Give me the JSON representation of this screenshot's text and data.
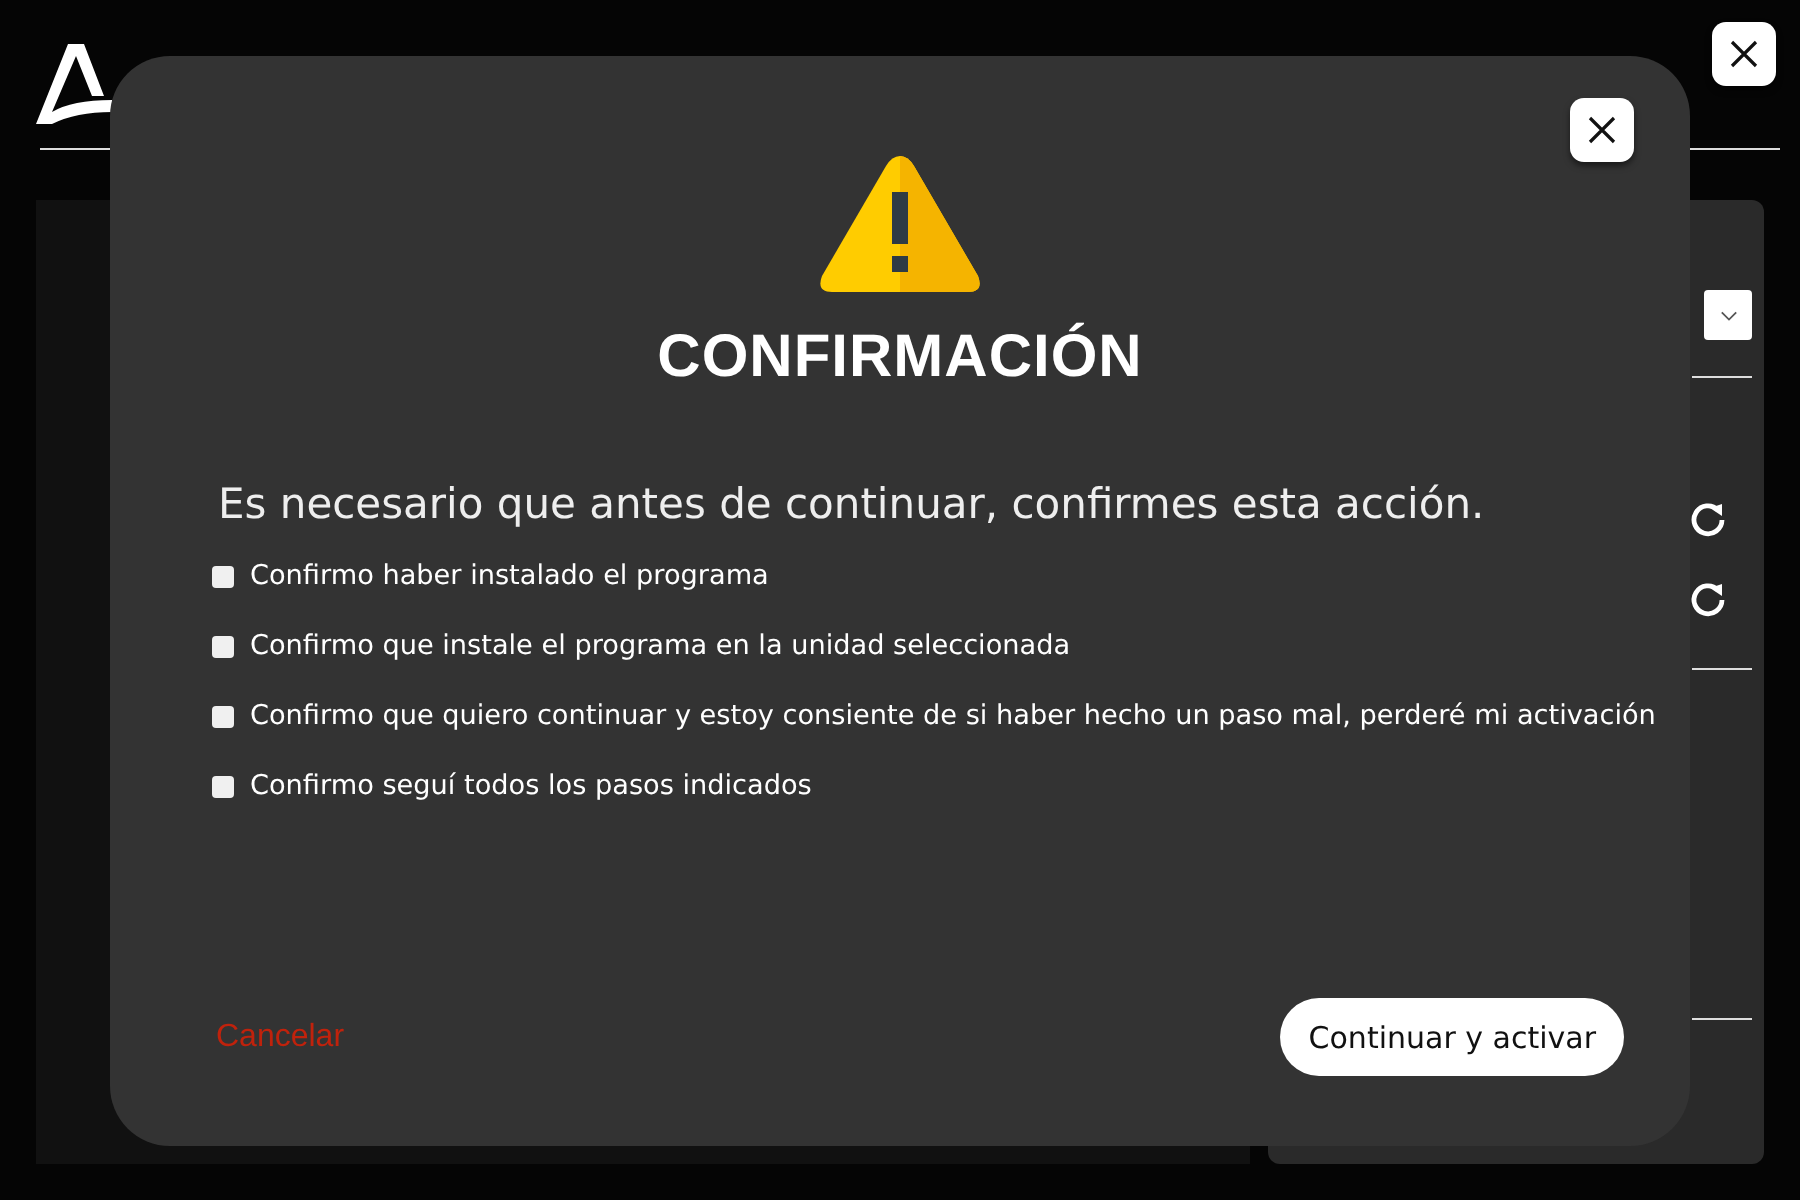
{
  "dialog": {
    "title": "CONFIRMACIÓN",
    "message": "Es necesario que antes de continuar, confirmes esta acción.",
    "confirmations": [
      {
        "label": "Confirmo haber instalado el programa",
        "checked": false
      },
      {
        "label": "Confirmo que instale el programa en la unidad seleccionada",
        "checked": false
      },
      {
        "label": "Confirmo que quiero continuar y estoy consiente de si haber hecho un paso mal, perderé mi activación",
        "checked": false
      },
      {
        "label": "Confirmo seguí todos los pasos indicados",
        "checked": false
      }
    ],
    "cancel_label": "Cancelar",
    "confirm_label": "Continuar y activar"
  }
}
